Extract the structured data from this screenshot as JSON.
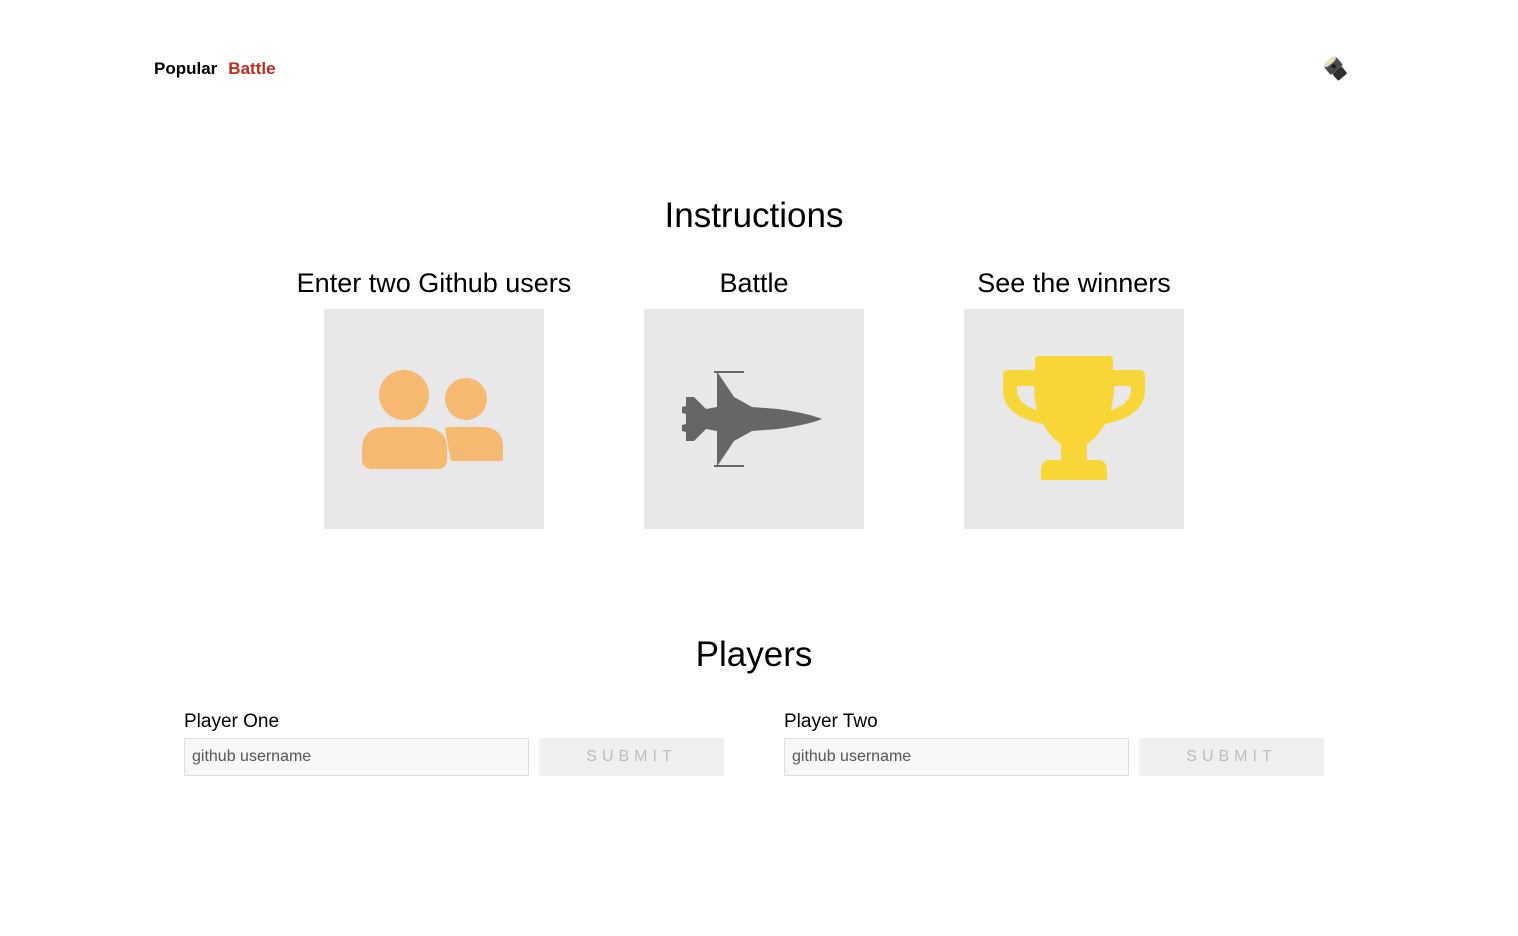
{
  "nav": {
    "items": [
      {
        "label": "Popular",
        "active": false
      },
      {
        "label": "Battle",
        "active": true
      }
    ],
    "theme_toggle_icon": "flashlight-icon",
    "active_color": "#bb2e1f"
  },
  "instructions": {
    "title": "Instructions",
    "steps": [
      {
        "label": "Enter two Github users",
        "icon": "users-icon",
        "icon_color": "#f5b971"
      },
      {
        "label": "Battle",
        "icon": "fighter-jet-icon",
        "icon_color": "#666666"
      },
      {
        "label": "See the winners",
        "icon": "trophy-icon",
        "icon_color": "#f8d637"
      }
    ]
  },
  "players": {
    "title": "Players",
    "player_one": {
      "label": "Player One",
      "placeholder": "github username",
      "value": "",
      "submit_label": "Submit",
      "submit_enabled": false
    },
    "player_two": {
      "label": "Player Two",
      "placeholder": "github username",
      "value": "",
      "submit_label": "Submit",
      "submit_enabled": false
    }
  }
}
